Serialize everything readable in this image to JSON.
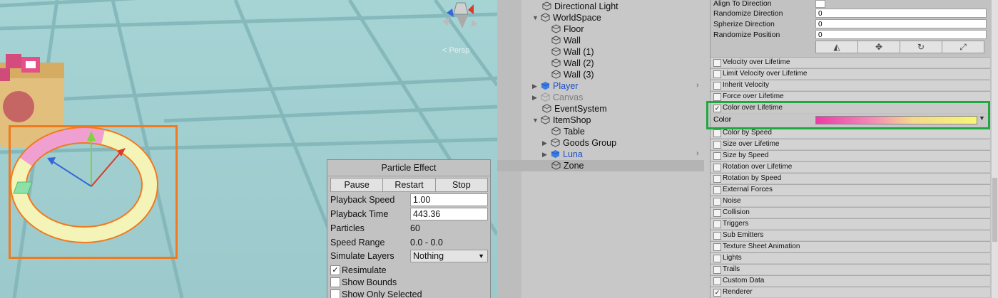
{
  "scene": {
    "persp_label": "< Persp",
    "particle_panel": {
      "title": "Particle Effect",
      "buttons": [
        "Pause",
        "Restart",
        "Stop"
      ],
      "playback_speed_label": "Playback Speed",
      "playback_speed_value": "1.00",
      "playback_time_label": "Playback Time",
      "playback_time_value": "443.36",
      "particles_label": "Particles",
      "particles_value": "60",
      "speed_range_label": "Speed Range",
      "speed_range_value": "0.0 - 0.0",
      "simulate_layers_label": "Simulate Layers",
      "simulate_layers_value": "Nothing",
      "resimulate_label": "Resimulate",
      "resimulate_checked": true,
      "show_bounds_label": "Show Bounds",
      "show_only_selected_label": "Show Only Selected"
    }
  },
  "hierarchy": {
    "items": [
      {
        "label": "Directional Light"
      },
      {
        "label": "WorldSpace"
      },
      {
        "label": "Floor"
      },
      {
        "label": "Wall"
      },
      {
        "label": "Wall (1)"
      },
      {
        "label": "Wall (2)"
      },
      {
        "label": "Wall (3)"
      },
      {
        "label": "Player"
      },
      {
        "label": "Canvas"
      },
      {
        "label": "EventSystem"
      },
      {
        "label": "ItemShop"
      },
      {
        "label": "Table"
      },
      {
        "label": "Goods Group"
      },
      {
        "label": "Luna"
      },
      {
        "label": "Zone"
      }
    ]
  },
  "inspector": {
    "props": [
      {
        "label": "Align To Direction",
        "value": ""
      },
      {
        "label": "Randomize Direction",
        "value": "0"
      },
      {
        "label": "Spherize Direction",
        "value": "0"
      },
      {
        "label": "Randomize Position",
        "value": "0"
      }
    ],
    "modules": [
      {
        "label": "Velocity over Lifetime",
        "checked": false
      },
      {
        "label": "Limit Velocity over Lifetime",
        "checked": false
      },
      {
        "label": "Inherit Velocity",
        "checked": false
      },
      {
        "label": "Force over Lifetime",
        "checked": false
      },
      {
        "label": "Color over Lifetime",
        "checked": true
      },
      {
        "label": "Color by Speed",
        "checked": false
      },
      {
        "label": "Size over Lifetime",
        "checked": false
      },
      {
        "label": "Size by Speed",
        "checked": false
      },
      {
        "label": "Rotation over Lifetime",
        "checked": false
      },
      {
        "label": "Rotation by Speed",
        "checked": false
      },
      {
        "label": "External Forces",
        "checked": false
      },
      {
        "label": "Noise",
        "checked": false
      },
      {
        "label": "Collision",
        "checked": false
      },
      {
        "label": "Triggers",
        "checked": false
      },
      {
        "label": "Sub Emitters",
        "checked": false
      },
      {
        "label": "Texture Sheet Animation",
        "checked": false
      },
      {
        "label": "Lights",
        "checked": false
      },
      {
        "label": "Trails",
        "checked": false
      },
      {
        "label": "Custom Data",
        "checked": false
      },
      {
        "label": "Renderer",
        "checked": true
      }
    ],
    "color_label": "Color",
    "color_gradient": [
      "#ee3aa8",
      "#f58ab7",
      "#f5d88a",
      "#f7f675"
    ]
  },
  "colors": {
    "highlight_green": "#1fa83f",
    "highlight_orange": "#f07a1e",
    "prefab_blue": "#1c4fc7"
  }
}
